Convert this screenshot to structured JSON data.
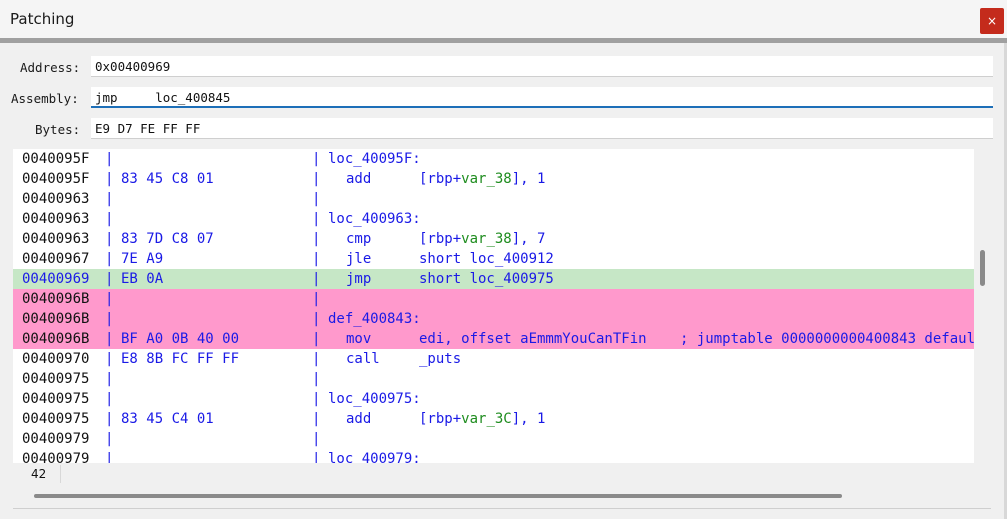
{
  "window": {
    "title": "Patching",
    "close_label": "×"
  },
  "fields": {
    "address": {
      "label": "Address:",
      "value": "0x00400969"
    },
    "assembly": {
      "label": "Assembly:",
      "value": "jmp     loc_400845"
    },
    "bytes": {
      "label": "Bytes:",
      "value": "E9 D7 FE FF FF"
    }
  },
  "colors": {
    "highlight_green": "#c6e7c6",
    "highlight_pink": "#ff99cc",
    "text_blue": "#1a1ae6",
    "text_green": "#1e8c1e",
    "close_red": "#c42b1c"
  },
  "listing": [
    {
      "addr": "0040095F",
      "bytes": "",
      "label": "loc_40095F:",
      "mn": "",
      "op": [],
      "hl": "none",
      "addr_color": "#111111"
    },
    {
      "addr": "0040095F",
      "bytes": "83 45 C8 01",
      "label": "",
      "mn": "add",
      "op": [
        [
          "[rbp+",
          "b"
        ],
        [
          "var_38",
          "g"
        ],
        [
          "], 1",
          "b"
        ]
      ],
      "hl": "none",
      "addr_color": "#111111"
    },
    {
      "addr": "00400963",
      "bytes": "",
      "label": "",
      "mn": "",
      "op": [],
      "hl": "none",
      "addr_color": "#111111"
    },
    {
      "addr": "00400963",
      "bytes": "",
      "label": "loc_400963:",
      "mn": "",
      "op": [],
      "hl": "none",
      "addr_color": "#111111"
    },
    {
      "addr": "00400963",
      "bytes": "83 7D C8 07",
      "label": "",
      "mn": "cmp",
      "op": [
        [
          "[rbp+",
          "b"
        ],
        [
          "var_38",
          "g"
        ],
        [
          "], 7",
          "b"
        ]
      ],
      "hl": "none",
      "addr_color": "#111111"
    },
    {
      "addr": "00400967",
      "bytes": "7E A9",
      "label": "",
      "mn": "jle",
      "op": [
        [
          "short loc_400912",
          "b"
        ]
      ],
      "hl": "none",
      "addr_color": "#111111"
    },
    {
      "addr": "00400969",
      "bytes": "EB 0A",
      "label": "",
      "mn": "jmp",
      "op": [
        [
          "short loc_400975",
          "b"
        ]
      ],
      "hl": "green",
      "addr_color": "#1a1ae6"
    },
    {
      "addr": "0040096B",
      "bytes": "",
      "label": "",
      "mn": "",
      "op": [],
      "hl": "pink",
      "addr_color": "#111111"
    },
    {
      "addr": "0040096B",
      "bytes": "",
      "label": "def_400843:",
      "mn": "",
      "op": [],
      "hl": "pink",
      "addr_color": "#111111"
    },
    {
      "addr": "0040096B",
      "bytes": "BF A0 0B 40 00",
      "label": "",
      "mn": "mov",
      "op": [
        [
          "edi, offset aEmmmYouCanTFin",
          "b"
        ]
      ],
      "cmt": "; jumptable 0000000000400843 defaul",
      "hl": "pink",
      "addr_color": "#111111"
    },
    {
      "addr": "00400970",
      "bytes": "E8 8B FC FF FF",
      "label": "",
      "mn": "call",
      "op": [
        [
          "_puts",
          "b"
        ]
      ],
      "hl": "none",
      "addr_color": "#111111"
    },
    {
      "addr": "00400975",
      "bytes": "",
      "label": "",
      "mn": "",
      "op": [],
      "hl": "none",
      "addr_color": "#111111"
    },
    {
      "addr": "00400975",
      "bytes": "",
      "label": "loc_400975:",
      "mn": "",
      "op": [],
      "hl": "none",
      "addr_color": "#111111"
    },
    {
      "addr": "00400975",
      "bytes": "83 45 C4 01",
      "label": "",
      "mn": "add",
      "op": [
        [
          "[rbp+",
          "b"
        ],
        [
          "var_3C",
          "g"
        ],
        [
          "], 1",
          "b"
        ]
      ],
      "hl": "none",
      "addr_color": "#111111"
    },
    {
      "addr": "00400979",
      "bytes": "",
      "label": "",
      "mn": "",
      "op": [],
      "hl": "none",
      "addr_color": "#111111"
    },
    {
      "addr": "00400979",
      "bytes": "",
      "label": "loc_400979:",
      "mn": "",
      "op": [],
      "hl": "none",
      "addr_color": "#111111"
    }
  ],
  "status": {
    "line_count": "42"
  }
}
